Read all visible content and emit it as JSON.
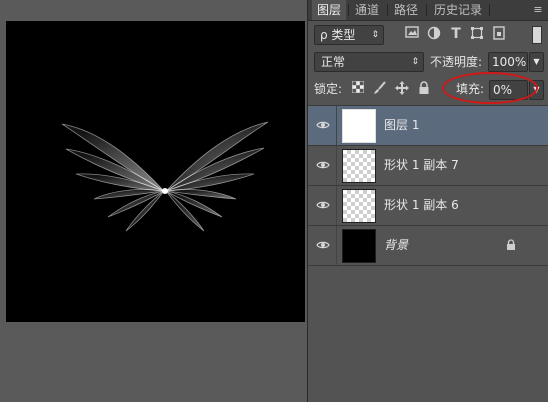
{
  "tabs": [
    {
      "label": "图层",
      "active": true
    },
    {
      "label": "通道",
      "active": false
    },
    {
      "label": "路径",
      "active": false
    },
    {
      "label": "历史记录",
      "active": false
    }
  ],
  "filter": {
    "kind_label": "ρ 类型"
  },
  "blend": {
    "mode": "正常",
    "opacity_label": "不透明度:",
    "opacity_value": "100%"
  },
  "lock": {
    "label": "锁定:",
    "fill_label": "填充:",
    "fill_value": "0%"
  },
  "layers": [
    {
      "name": "图层 1",
      "thumb": "white",
      "selected": true,
      "locked": false,
      "italic": false
    },
    {
      "name": "形状 1 副本 7",
      "thumb": "transparent",
      "selected": false,
      "locked": false,
      "italic": false
    },
    {
      "name": "形状 1 副本 6",
      "thumb": "transparent",
      "selected": false,
      "locked": false,
      "italic": false
    },
    {
      "name": "背景",
      "thumb": "black",
      "selected": false,
      "locked": true,
      "italic": true
    }
  ],
  "colors": {
    "panel_bg": "#535353",
    "selected_row": "#5c6a7d",
    "highlight_circle": "#d01818",
    "canvas": "#000000"
  }
}
